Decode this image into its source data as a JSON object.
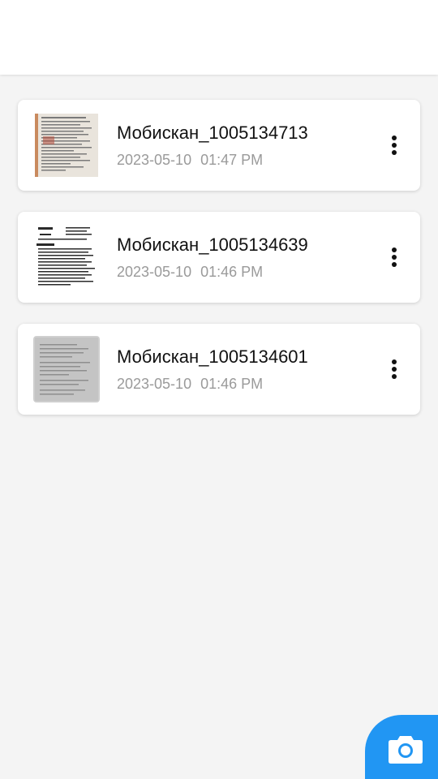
{
  "documents": [
    {
      "title": "Мобискан_1005134713",
      "date": "2023-05-10",
      "time": "01:47 PM",
      "thumbnail_icon": "scanned-page-thumbnail-icon"
    },
    {
      "title": "Мобискан_1005134639",
      "date": "2023-05-10",
      "time": "01:46 PM",
      "thumbnail_icon": "scanned-page-thumbnail-icon"
    },
    {
      "title": "Мобискан_1005134601",
      "date": "2023-05-10",
      "time": "01:46 PM",
      "thumbnail_icon": "scanned-page-thumbnail-icon"
    }
  ],
  "item_menu_icon": "more-vertical-icon",
  "fab": {
    "icon": "camera-icon",
    "color": "#2196f3"
  },
  "colors": {
    "background": "#f4f4f4",
    "card": "#ffffff",
    "title_text": "#111111",
    "meta_text": "#9a9a9a",
    "accent": "#2196f3"
  }
}
